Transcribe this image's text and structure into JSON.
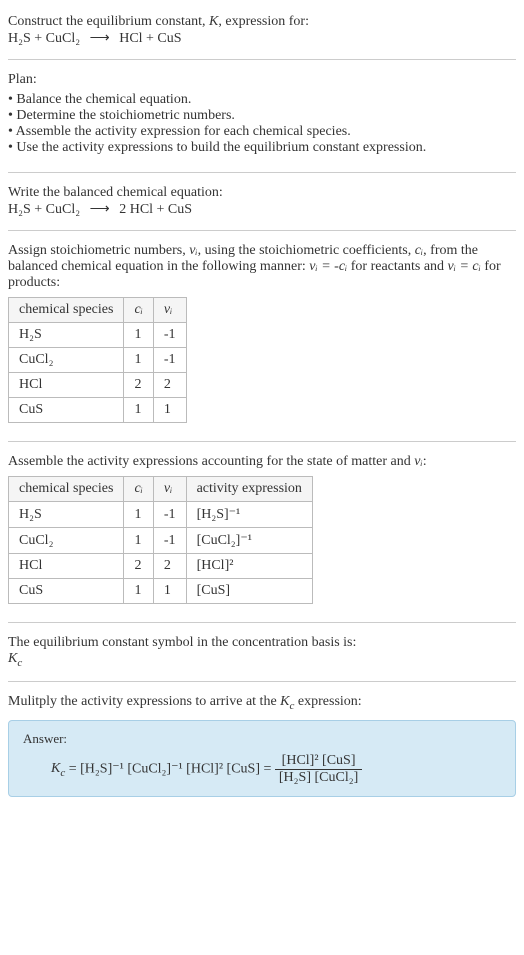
{
  "intro": {
    "line1_prefix": "Construct the equilibrium constant, ",
    "line1_k": "K",
    "line1_suffix": ", expression for:",
    "eq_lhs": "H₂S + CuCl₂",
    "eq_arrow": "⟶",
    "eq_rhs": "HCl + CuS"
  },
  "plan": {
    "title": "Plan:",
    "items": [
      "Balance the chemical equation.",
      "Determine the stoichiometric numbers.",
      "Assemble the activity expression for each chemical species.",
      "Use the activity expressions to build the equilibrium constant expression."
    ]
  },
  "balanced": {
    "label": "Write the balanced chemical equation:",
    "eq_lhs": "H₂S + CuCl₂",
    "eq_arrow": "⟶",
    "eq_rhs": "2 HCl + CuS"
  },
  "stoich": {
    "text_a": "Assign stoichiometric numbers, ",
    "nu_i": "νᵢ",
    "text_b": ", using the stoichiometric coefficients, ",
    "c_i": "cᵢ",
    "text_c": ", from the balanced chemical equation in the following manner: ",
    "rel1": "νᵢ = -cᵢ",
    "text_d": " for reactants and ",
    "rel2": "νᵢ = cᵢ",
    "text_e": " for products:",
    "headers": [
      "chemical species",
      "cᵢ",
      "νᵢ"
    ],
    "rows": [
      [
        "H₂S",
        "1",
        "-1"
      ],
      [
        "CuCl₂",
        "1",
        "-1"
      ],
      [
        "HCl",
        "2",
        "2"
      ],
      [
        "CuS",
        "1",
        "1"
      ]
    ]
  },
  "activity": {
    "text_a": "Assemble the activity expressions accounting for the state of matter and ",
    "nu_i": "νᵢ",
    "text_b": ":",
    "headers": [
      "chemical species",
      "cᵢ",
      "νᵢ",
      "activity expression"
    ],
    "rows": [
      [
        "H₂S",
        "1",
        "-1",
        "[H₂S]⁻¹"
      ],
      [
        "CuCl₂",
        "1",
        "-1",
        "[CuCl₂]⁻¹"
      ],
      [
        "HCl",
        "2",
        "2",
        "[HCl]²"
      ],
      [
        "CuS",
        "1",
        "1",
        "[CuS]"
      ]
    ]
  },
  "basis": {
    "text": "The equilibrium constant symbol in the concentration basis is:",
    "symbol": "K",
    "sub": "c"
  },
  "multiply": {
    "text_a": "Mulitply the activity expressions to arrive at the ",
    "kc": "K",
    "kc_sub": "c",
    "text_b": " expression:"
  },
  "answer": {
    "label": "Answer:",
    "kc": "K",
    "kc_sub": "c",
    "eq": " = [H₂S]⁻¹ [CuCl₂]⁻¹ [HCl]² [CuS] = ",
    "frac_num": "[HCl]² [CuS]",
    "frac_den": "[H₂S] [CuCl₂]"
  },
  "chart_data": {
    "type": "table",
    "tables": [
      {
        "title": "stoichiometric numbers",
        "headers": [
          "chemical species",
          "c_i",
          "nu_i"
        ],
        "rows": [
          {
            "species": "H2S",
            "c_i": 1,
            "nu_i": -1
          },
          {
            "species": "CuCl2",
            "c_i": 1,
            "nu_i": -1
          },
          {
            "species": "HCl",
            "c_i": 2,
            "nu_i": 2
          },
          {
            "species": "CuS",
            "c_i": 1,
            "nu_i": 1
          }
        ]
      },
      {
        "title": "activity expressions",
        "headers": [
          "chemical species",
          "c_i",
          "nu_i",
          "activity expression"
        ],
        "rows": [
          {
            "species": "H2S",
            "c_i": 1,
            "nu_i": -1,
            "activity": "[H2S]^-1"
          },
          {
            "species": "CuCl2",
            "c_i": 1,
            "nu_i": -1,
            "activity": "[CuCl2]^-1"
          },
          {
            "species": "HCl",
            "c_i": 2,
            "nu_i": 2,
            "activity": "[HCl]^2"
          },
          {
            "species": "CuS",
            "c_i": 1,
            "nu_i": 1,
            "activity": "[CuS]"
          }
        ]
      }
    ]
  }
}
